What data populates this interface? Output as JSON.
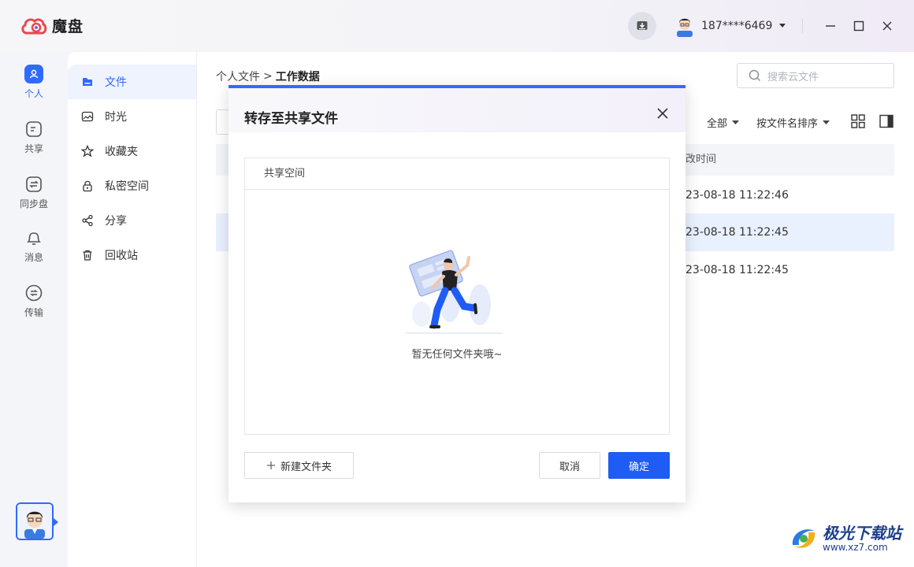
{
  "app": {
    "name": "魔盘"
  },
  "header": {
    "download_icon": "download-icon",
    "user_name": "187****6469",
    "window_controls": [
      "minimize",
      "maximize",
      "close"
    ]
  },
  "rail": {
    "items": [
      {
        "label": "个人",
        "icon": "person-icon",
        "active": true
      },
      {
        "label": "共享",
        "icon": "share-folder-icon"
      },
      {
        "label": "同步盘",
        "icon": "sync-icon"
      },
      {
        "label": "消息",
        "icon": "bell-icon"
      },
      {
        "label": "传输",
        "icon": "transfer-icon"
      }
    ]
  },
  "sidebar": {
    "items": [
      {
        "label": "文件",
        "icon": "folder-icon",
        "active": true
      },
      {
        "label": "时光",
        "icon": "image-icon"
      },
      {
        "label": "收藏夹",
        "icon": "star-icon"
      },
      {
        "label": "私密空间",
        "icon": "lock-icon"
      },
      {
        "label": "分享",
        "icon": "share-icon"
      },
      {
        "label": "回收站",
        "icon": "trash-icon"
      }
    ]
  },
  "main": {
    "breadcrumb": {
      "root": "个人文件",
      "separator": ">",
      "current": "工作数据"
    },
    "search_placeholder": "搜索云文件",
    "filter_label": "全部",
    "sort_label": "按文件名排序",
    "table": {
      "header_time": "改时间",
      "rows": [
        {
          "time": "23-08-18 11:22:46",
          "selected": false
        },
        {
          "time": "23-08-18 11:22:45",
          "selected": true
        },
        {
          "time": "23-08-18 11:22:45",
          "selected": false
        }
      ]
    }
  },
  "modal": {
    "title": "转存至共享文件",
    "box_header": "共享空间",
    "empty_text": "暂无任何文件夹哦~",
    "new_folder_label": "新建文件夹",
    "cancel_label": "取消",
    "confirm_label": "确定"
  },
  "colors": {
    "accent": "#2f6bff",
    "primary_button": "#1e5cf5",
    "selected_row": "#eaf1fe"
  },
  "watermark": {
    "title": "极光下载站",
    "url": "www.xz7.com"
  }
}
